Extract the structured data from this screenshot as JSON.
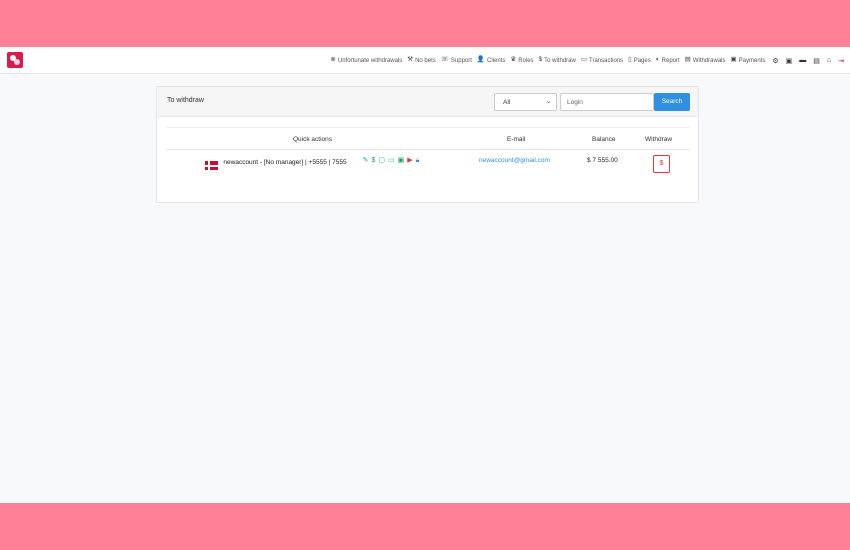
{
  "nav": {
    "items": [
      {
        "icon": "⊗",
        "label": "Unfortunate withdrawals"
      },
      {
        "icon": "⚒",
        "label": "No bets"
      },
      {
        "icon": "☏",
        "label": "Support"
      },
      {
        "icon": "👤",
        "label": "Clients"
      },
      {
        "icon": "♛",
        "label": "Roles"
      },
      {
        "icon": "$",
        "label": "To withdraw"
      },
      {
        "icon": "▭",
        "label": "Transactions"
      },
      {
        "icon": "▯",
        "label": "Pages"
      },
      {
        "icon": "◐",
        "label": "Report"
      },
      {
        "icon": "▤",
        "label": "Withdrawals"
      },
      {
        "icon": "▣",
        "label": "Payments"
      }
    ],
    "icons": [
      "⚙",
      "▣",
      "▬",
      "▤",
      "⌂",
      "⇥"
    ]
  },
  "card": {
    "title": "To withdraw",
    "filter_value": "All",
    "login_placeholder": "Login",
    "search_label": "Search"
  },
  "table": {
    "headers": {
      "quick_actions": "Quick actions",
      "email": "E-mail",
      "balance": "Balance",
      "withdraw": "Withdraw"
    },
    "rows": [
      {
        "account": "newaccount - [No manager] | +5555 | 7555",
        "email": "newaccount@gmail.com",
        "balance": "$ 7 555.00",
        "withdraw_icon": "$"
      }
    ]
  }
}
